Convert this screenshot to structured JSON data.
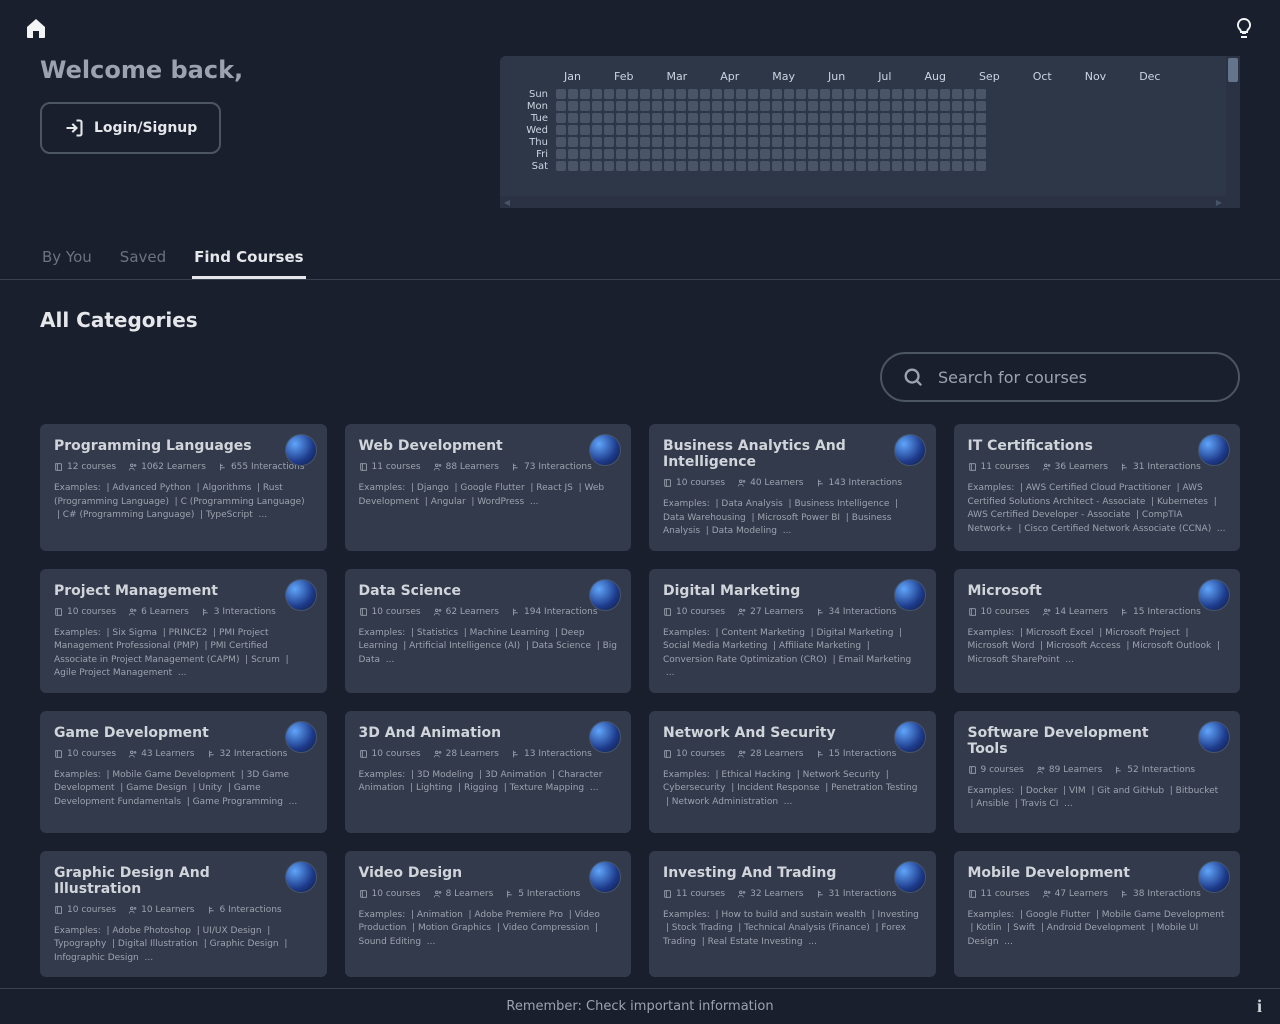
{
  "header": {
    "welcome": "Welcome back,",
    "login_label": "Login/Signup",
    "months": [
      "Jan",
      "Feb",
      "Mar",
      "Apr",
      "May",
      "Jun",
      "Jul",
      "Aug",
      "Sep",
      "Oct",
      "Nov",
      "Dec"
    ],
    "days": [
      "Sun",
      "Mon",
      "Tue",
      "Wed",
      "Thu",
      "Fri",
      "Sat"
    ]
  },
  "tabs": {
    "by_you": "By You",
    "saved": "Saved",
    "find": "Find Courses"
  },
  "section_title": "All Categories",
  "search": {
    "placeholder": "Search for courses"
  },
  "cards": [
    {
      "title": "Programming Languages",
      "courses": "12 courses",
      "learners": "1062 Learners",
      "interactions": "655 Interactions",
      "examples": [
        "Advanced Python",
        "Algorithms",
        "Rust (Programming Language)",
        "C (Programming Language)",
        "C# (Programming Language)",
        "TypeScript"
      ]
    },
    {
      "title": "Web Development",
      "courses": "11 courses",
      "learners": "88 Learners",
      "interactions": "73 Interactions",
      "examples": [
        "Django",
        "Google Flutter",
        "React JS",
        "Web Development",
        "Angular",
        "WordPress"
      ]
    },
    {
      "title": "Business Analytics And Intelligence",
      "courses": "10 courses",
      "learners": "40 Learners",
      "interactions": "143 Interactions",
      "examples": [
        "Data Analysis",
        "Business Intelligence",
        "Data Warehousing",
        "Microsoft Power BI",
        "Business Analysis",
        "Data Modeling"
      ]
    },
    {
      "title": "IT Certifications",
      "courses": "11 courses",
      "learners": "36 Learners",
      "interactions": "31 Interactions",
      "examples": [
        "AWS Certified Cloud Practitioner",
        "AWS Certified Solutions Architect - Associate",
        "Kubernetes",
        "AWS Certified Developer - Associate",
        "CompTIA Network+",
        "Cisco Certified Network Associate (CCNA)"
      ]
    },
    {
      "title": "Project Management",
      "courses": "10 courses",
      "learners": "6 Learners",
      "interactions": "3 Interactions",
      "examples": [
        "Six Sigma",
        "PRINCE2",
        "PMI Project Management Professional (PMP)",
        "PMI Certified Associate in Project Management (CAPM)",
        "Scrum",
        "Agile Project Management"
      ]
    },
    {
      "title": "Data Science",
      "courses": "10 courses",
      "learners": "62 Learners",
      "interactions": "194 Interactions",
      "examples": [
        "Statistics",
        "Machine Learning",
        "Deep Learning",
        "Artificial Intelligence (AI)",
        "Data Science",
        "Big Data"
      ]
    },
    {
      "title": "Digital Marketing",
      "courses": "10 courses",
      "learners": "27 Learners",
      "interactions": "34 Interactions",
      "examples": [
        "Content Marketing",
        "Digital Marketing",
        "Social Media Marketing",
        "Affiliate Marketing",
        "Conversion Rate Optimization (CRO)",
        "Email Marketing"
      ]
    },
    {
      "title": "Microsoft",
      "courses": "10 courses",
      "learners": "14 Learners",
      "interactions": "15 Interactions",
      "examples": [
        "Microsoft Excel",
        "Microsoft Project",
        "Microsoft Word",
        "Microsoft Access",
        "Microsoft Outlook",
        "Microsoft SharePoint"
      ]
    },
    {
      "title": "Game Development",
      "courses": "10 courses",
      "learners": "43 Learners",
      "interactions": "32 Interactions",
      "examples": [
        "Mobile Game Development",
        "3D Game Development",
        "Game Design",
        "Unity",
        "Game Development Fundamentals",
        "Game Programming"
      ]
    },
    {
      "title": "3D And Animation",
      "courses": "10 courses",
      "learners": "28 Learners",
      "interactions": "13 Interactions",
      "examples": [
        "3D Modeling",
        "3D Animation",
        "Character Animation",
        "Lighting",
        "Rigging",
        "Texture Mapping"
      ]
    },
    {
      "title": "Network And Security",
      "courses": "10 courses",
      "learners": "28 Learners",
      "interactions": "15 Interactions",
      "examples": [
        "Ethical Hacking",
        "Network Security",
        "Cybersecurity",
        "Incident Response",
        "Penetration Testing",
        "Network Administration"
      ]
    },
    {
      "title": "Software Development Tools",
      "courses": "9 courses",
      "learners": "89 Learners",
      "interactions": "52 Interactions",
      "examples": [
        "Docker",
        "VIM",
        "Git and GitHub",
        "Bitbucket",
        "Ansible",
        "Travis CI"
      ]
    },
    {
      "title": "Graphic Design And Illustration",
      "courses": "10 courses",
      "learners": "10 Learners",
      "interactions": "6 Interactions",
      "examples": [
        "Adobe Photoshop",
        "UI/UX Design",
        "Typography",
        "Digital Illustration",
        "Graphic Design",
        "Infographic Design"
      ]
    },
    {
      "title": "Video Design",
      "courses": "10 courses",
      "learners": "8 Learners",
      "interactions": "5 Interactions",
      "examples": [
        "Animation",
        "Adobe Premiere Pro",
        "Video Production",
        "Motion Graphics",
        "Video Compression",
        "Sound Editing"
      ]
    },
    {
      "title": "Investing And Trading",
      "courses": "11 courses",
      "learners": "32 Learners",
      "interactions": "31 Interactions",
      "examples": [
        "How to build and sustain wealth",
        "Investing",
        "Stock Trading",
        "Technical Analysis (Finance)",
        "Forex Trading",
        "Real Estate Investing"
      ]
    },
    {
      "title": "Mobile Development",
      "courses": "11 courses",
      "learners": "47 Learners",
      "interactions": "38 Interactions",
      "examples": [
        "Google Flutter",
        "Mobile Game Development",
        "Kotlin",
        "Swift",
        "Android Development",
        "Mobile UI Design"
      ]
    }
  ],
  "footer": {
    "reminder": "Remember: Check important information",
    "examples_label": "Examples:"
  }
}
